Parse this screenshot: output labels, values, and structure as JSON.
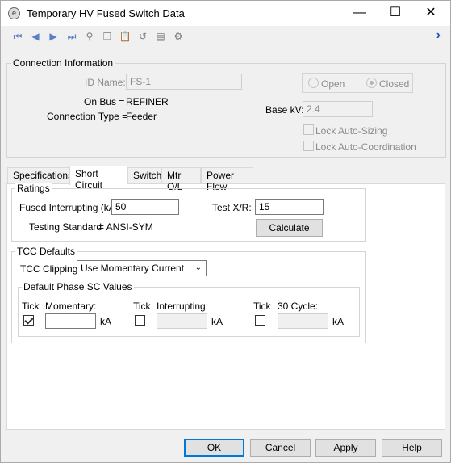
{
  "window": {
    "title": "Temporary HV Fused Switch Data",
    "minimize": "—",
    "maximize": "☐",
    "close": "✕"
  },
  "toolbar": {
    "icons": [
      "first-record-icon",
      "previous-record-icon",
      "next-record-icon",
      "last-record-icon",
      "find-icon",
      "copy-icon",
      "paste-icon",
      "undo-icon",
      "save-library-icon",
      "settings-icon",
      "next-page-icon"
    ]
  },
  "connection": {
    "legend": "Connection Information",
    "id_label": "ID Name:",
    "id_value": "FS-1",
    "on_bus_label": "On Bus =",
    "on_bus_value": "REFINER",
    "conn_type_label": "Connection Type =",
    "conn_type_value": "Feeder",
    "open_label": "Open",
    "closed_label": "Closed",
    "base_kv_label": "Base kV:",
    "base_kv_value": "2.4",
    "lock_auto_sizing": "Lock Auto-Sizing",
    "lock_auto_coordination": "Lock Auto-Coordination"
  },
  "tabs": [
    "Specifications",
    "Short Circuit",
    "Switch",
    "Mtr O/L",
    "Power Flow"
  ],
  "ratings": {
    "legend": "Ratings",
    "fused_label": "Fused Interrupting (kA):",
    "fused_value": "50",
    "test_xr_label": "Test X/R:",
    "test_xr_value": "15",
    "testing_standard_label": "Testing Standard",
    "testing_standard_value": "=  ANSI-SYM",
    "calculate_label": "Calculate"
  },
  "tcc": {
    "legend": "TCC Defaults",
    "clipping_label": "TCC Clipping:",
    "clipping_value": "Use Momentary Current",
    "phase_legend": "Default Phase SC Values",
    "tick_label": "Tick",
    "momentary_label": "Momentary:",
    "interrupting_label": "Interrupting:",
    "cycle30_label": "30 Cycle:",
    "unit": "kA",
    "momentary_value": "",
    "interrupting_value": "",
    "cycle30_value": ""
  },
  "buttons": {
    "ok": "OK",
    "cancel": "Cancel",
    "apply": "Apply",
    "help": "Help"
  },
  "colors": {
    "accent": "#0078d7",
    "toolbar_blue": "#5b7fc6"
  }
}
